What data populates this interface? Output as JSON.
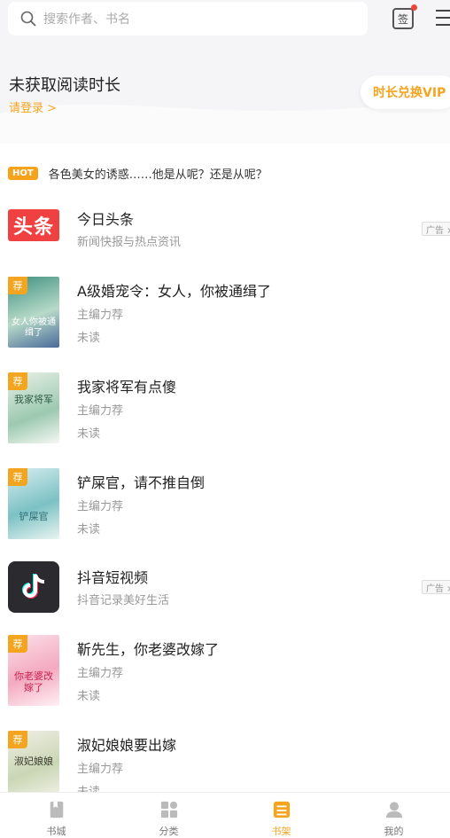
{
  "search": {
    "placeholder": "搜索作者、书名"
  },
  "header": {
    "sign_label": "签",
    "read_title": "未获取阅读时长",
    "login_link": "请登录 >",
    "vip_button": "时长兑换VIP"
  },
  "hot": {
    "badge": "HOT",
    "text": "各色美女的诱惑……他是从呢？还是从呢？"
  },
  "items": [
    {
      "title": "今日头条",
      "line1": "新闻快报与热点资讯",
      "ad": "广告 ×",
      "cover_text": "头条"
    },
    {
      "title": "A级婚宠令：女人，你被通缉了",
      "line1": "主编力荐",
      "line2": "未读",
      "tag": "荐",
      "cover_text": "女人你被通缉了"
    },
    {
      "title": "我家将军有点傻",
      "line1": "主编力荐",
      "line2": "未读",
      "tag": "荐",
      "cover_text": "我家将军"
    },
    {
      "title": "铲屎官，请不推自倒",
      "line1": "主编力荐",
      "line2": "未读",
      "tag": "荐",
      "cover_text": "铲屎官"
    },
    {
      "title": "抖音短视频",
      "line1": "抖音记录美好生活",
      "ad": "广告 ×"
    },
    {
      "title": "靳先生，你老婆改嫁了",
      "line1": "主编力荐",
      "line2": "未读",
      "tag": "荐",
      "cover_text": "你老婆改嫁了"
    },
    {
      "title": "淑妃娘娘要出嫁",
      "line1": "主编力荐",
      "line2": "未读",
      "tag": "荐",
      "cover_text": "淑妃娘娘"
    }
  ],
  "tabs": [
    {
      "label": "书城",
      "icon": "book-icon"
    },
    {
      "label": "分类",
      "icon": "grid-icon"
    },
    {
      "label": "书架",
      "icon": "bookshelf-icon"
    },
    {
      "label": "我的",
      "icon": "user-icon"
    }
  ],
  "colors": {
    "accent": "#f5a41f",
    "hot": "#f7a21b",
    "badge_dot": "#f0453a"
  }
}
